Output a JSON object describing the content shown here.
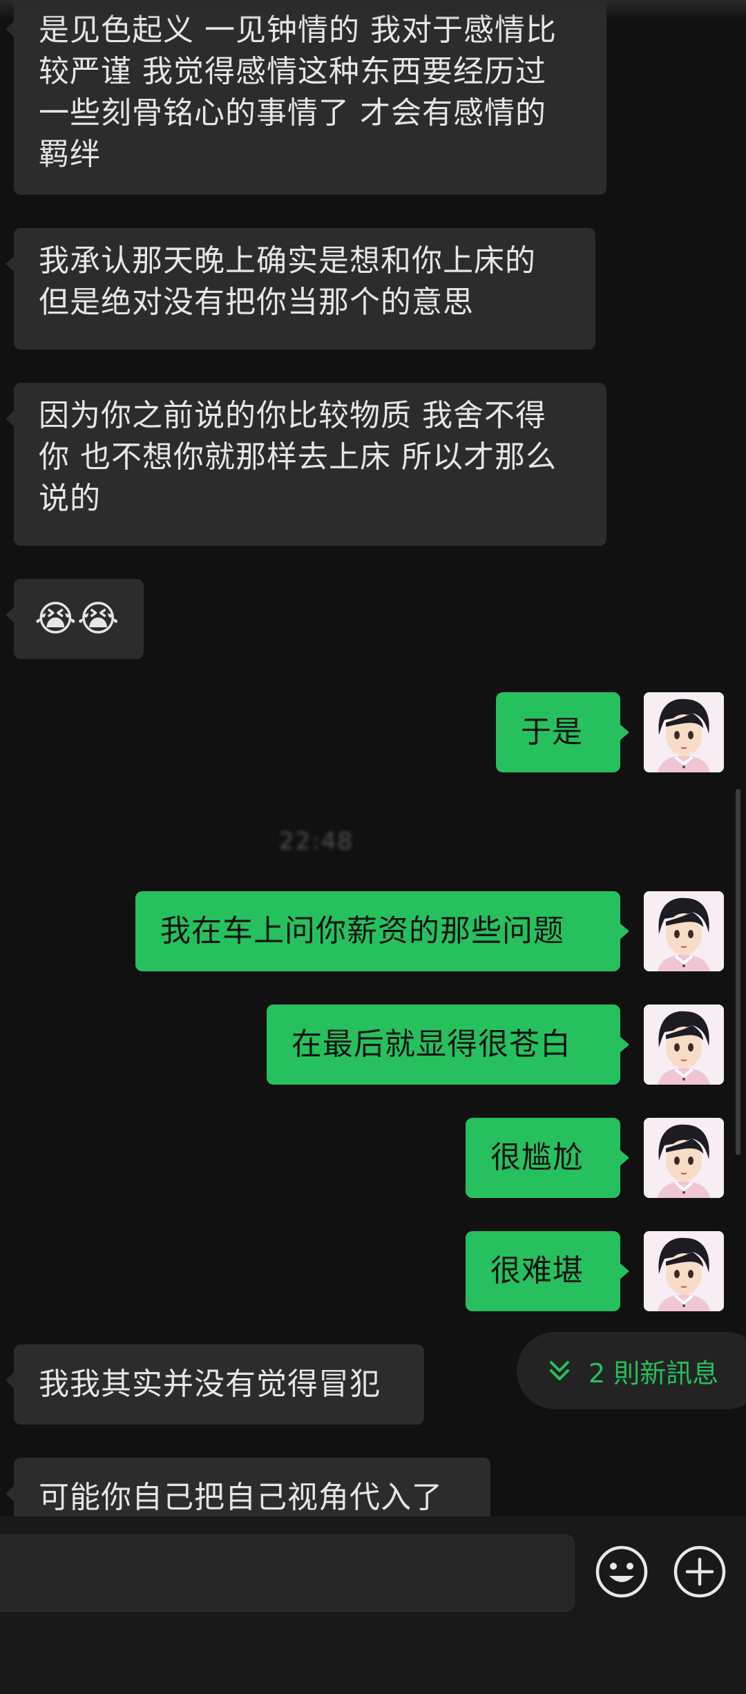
{
  "messages": {
    "incoming_1": "是见色起义 一见钟情的 我对于感情比\n较严谨 我觉得感情这种东西要经历过\n一些刻骨铭心的事情了 才会有感情的\n羁绊",
    "incoming_2": "我承认那天晚上确实是想和你上床的\n但是绝对没有把你当那个的意思",
    "incoming_3": "因为你之前说的你比较物质 我舍不得\n你 也不想你就那样去上床 所以才那么\n说的",
    "incoming_emoji": "😭😭",
    "outgoing_1": "于是",
    "outgoing_2": "我在车上问你薪资的那些问题",
    "outgoing_3": "在最后就显得很苍白",
    "outgoing_4": "很尴尬",
    "outgoing_5": "很难堪",
    "incoming_4": "我我其实并没有觉得冒犯",
    "incoming_5": "可能你自己把自己视角代入了"
  },
  "timestamp": "22:48",
  "new_messages_label": "2 則新訊息",
  "colors": {
    "background": "#111111",
    "incoming_bubble": "#2c2c2c",
    "outgoing_bubble": "#27c05f",
    "accent": "#27c05f"
  },
  "icons": {
    "emoji_button": "smiley-face-icon",
    "more_button": "plus-circle-icon",
    "new_messages": "double-chevron-down-icon"
  }
}
